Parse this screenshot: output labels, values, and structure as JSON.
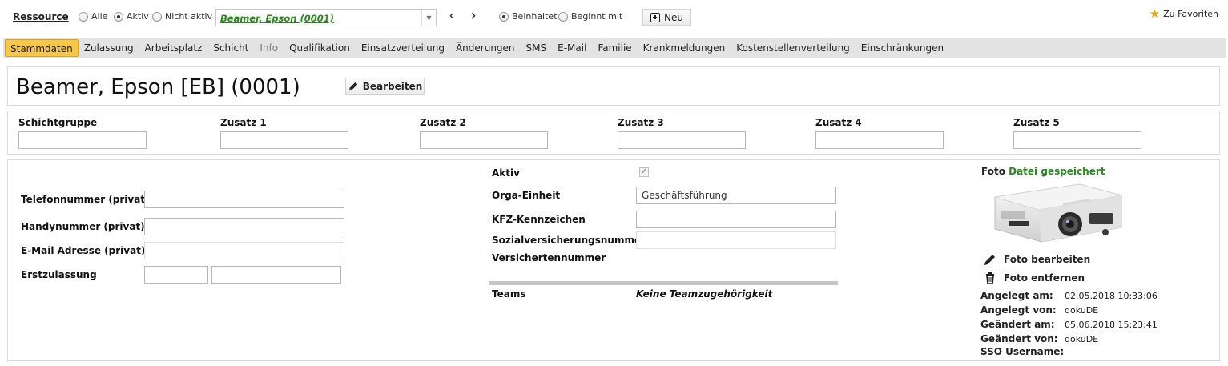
{
  "toolbar": {
    "resource_label": "Ressource",
    "filter_options": [
      {
        "label": "Alle",
        "selected": false
      },
      {
        "label": "Aktiv",
        "selected": true
      },
      {
        "label": "Nicht aktiv",
        "selected": false
      }
    ],
    "resource_value": "Beamer, Epson (0001)",
    "match_options": [
      {
        "label": "Beinhaltet",
        "selected": true
      },
      {
        "label": "Beginnt mit",
        "selected": false
      }
    ],
    "new_label": "Neu",
    "favorites_label": "Zu Favoriten"
  },
  "tabs": [
    {
      "label": "Stammdaten",
      "active": true
    },
    {
      "label": "Zulassung"
    },
    {
      "label": "Arbeitsplatz"
    },
    {
      "label": "Schicht"
    },
    {
      "label": "Info",
      "dim": true
    },
    {
      "label": "Qualifikation"
    },
    {
      "label": "Einsatzverteilung"
    },
    {
      "label": "Änderungen"
    },
    {
      "label": "SMS"
    },
    {
      "label": "E-Mail"
    },
    {
      "label": "Familie"
    },
    {
      "label": "Krankmeldungen"
    },
    {
      "label": "Kostenstellenverteilung"
    },
    {
      "label": "Einschränkungen"
    }
  ],
  "header": {
    "title": "Beamer, Epson [EB] (0001)",
    "edit_label": "Bearbeiten"
  },
  "zusatz": {
    "labels": [
      "Schichtgruppe",
      "Zusatz 1",
      "Zusatz 2",
      "Zusatz 3",
      "Zusatz 4",
      "Zusatz 5"
    ]
  },
  "left": {
    "telefon_label": "Telefonnummer (privat)",
    "handy_label": "Handynummer (privat)",
    "email_label": "E-Mail Adresse (privat)",
    "erstzulassung_label": "Erstzulassung"
  },
  "middle": {
    "aktiv_label": "Aktiv",
    "aktiv_checked": true,
    "orga_label": "Orga-Einheit",
    "orga_value": "Geschäftsführung",
    "kfz_label": "KFZ-Kennzeichen",
    "sv_label": "Sozialversicherungsnummer",
    "versicherten_label": "Versichertennummer",
    "teams_label": "Teams",
    "teams_value": "Keine Teamzugehörigkeit"
  },
  "right": {
    "foto_label": "Foto",
    "foto_status": "Datei gespeichert",
    "edit_photo_label": "Foto bearbeiten",
    "remove_photo_label": "Foto entfernen",
    "meta": [
      {
        "label": "Angelegt am:",
        "value": "02.05.2018 10:33:06"
      },
      {
        "label": "Angelegt von:",
        "value": "dokuDE"
      },
      {
        "label": "Geändert am:",
        "value": "05.06.2018 15:23:41"
      },
      {
        "label": "Geändert von:",
        "value": "dokuDE"
      },
      {
        "label": "SSO Username:",
        "value": ""
      }
    ]
  },
  "colors": {
    "accent_tab": "#f6c748",
    "link_green": "#2a8a1e",
    "favorite_star": "#e8a90c"
  }
}
